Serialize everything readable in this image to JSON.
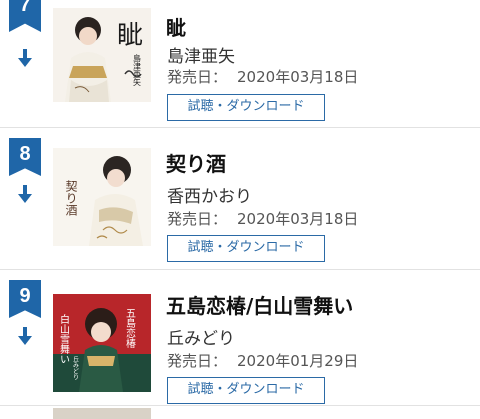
{
  "ranking": {
    "items": [
      {
        "rank": "7",
        "title": "眦",
        "artist": "島津亜矢",
        "release_label": "発売日：",
        "release_date": "2020年03月18日",
        "button_label": "試聴・ダウンロード",
        "cover_text": "眦",
        "cover_artist": "島津亜矢"
      },
      {
        "rank": "8",
        "title": "契り酒",
        "artist": "香西かおり",
        "release_label": "発売日：",
        "release_date": "2020年03月18日",
        "button_label": "試聴・ダウンロード",
        "cover_text": "契り酒",
        "cover_artist": ""
      },
      {
        "rank": "9",
        "title": "五島恋椿/白山雪舞い",
        "artist": "丘みどり",
        "release_label": "発売日：",
        "release_date": "2020年01月29日",
        "button_label": "試聴・ダウンロード",
        "cover_text": "五島恋椿",
        "cover_text_2": "白山雪舞い",
        "cover_artist": "丘みどり"
      }
    ]
  },
  "colors": {
    "accent": "#1f66a8",
    "button_border": "#2b6aa6",
    "divider": "#e2e2e2"
  },
  "icons": {
    "rank_change": "arrow-down-icon"
  }
}
